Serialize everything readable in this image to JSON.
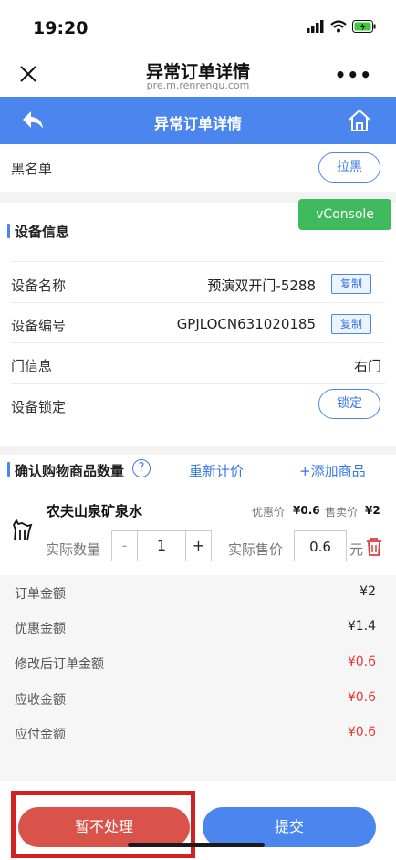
{
  "status": {
    "time": "19:20"
  },
  "browser": {
    "title": "异常订单详情",
    "url": "pre.m.renrenqu.com",
    "more": "•••"
  },
  "nav": {
    "title": "异常订单详情"
  },
  "blacklist": {
    "label": "黑名单",
    "button": "拉黑"
  },
  "vconsole": "vConsole",
  "device": {
    "section_title": "设备信息",
    "name_label": "设备名称",
    "name_value": "预演双开门-5288",
    "copy": "复制",
    "code_label": "设备编号",
    "code_value": "GPJLOCN631020185",
    "door_label": "门信息",
    "door_value": "右门",
    "lock_label": "设备锁定",
    "lock_button": "锁定"
  },
  "goods": {
    "section_title": "确认购物商品数量",
    "help_icon": "?",
    "recalc": "重新计价",
    "add": "+添加商品",
    "product_name": "农夫山泉矿泉水",
    "discount_label": "优惠价",
    "discount_value": "¥0.6",
    "price_label": "售卖价",
    "price_value": "¥2",
    "qty_label": "实际数量",
    "minus": "-",
    "qty": "1",
    "plus": "+",
    "actual_price_label": "实际售价",
    "actual_price": "0.6",
    "unit": "元"
  },
  "summary": [
    {
      "label": "订单金额",
      "value": "¥2",
      "red": false
    },
    {
      "label": "优惠金额",
      "value": "¥1.4",
      "red": false
    },
    {
      "label": "修改后订单金额",
      "value": "¥0.6",
      "red": true
    },
    {
      "label": "应收金额",
      "value": "¥0.6",
      "red": true
    },
    {
      "label": "应付金额",
      "value": "¥0.6",
      "red": true
    }
  ],
  "actions": {
    "hold": "暂不处理",
    "submit": "提交"
  },
  "colors": {
    "accent": "#4a86ee",
    "danger": "#e23a3a",
    "green": "#3fba5e"
  }
}
